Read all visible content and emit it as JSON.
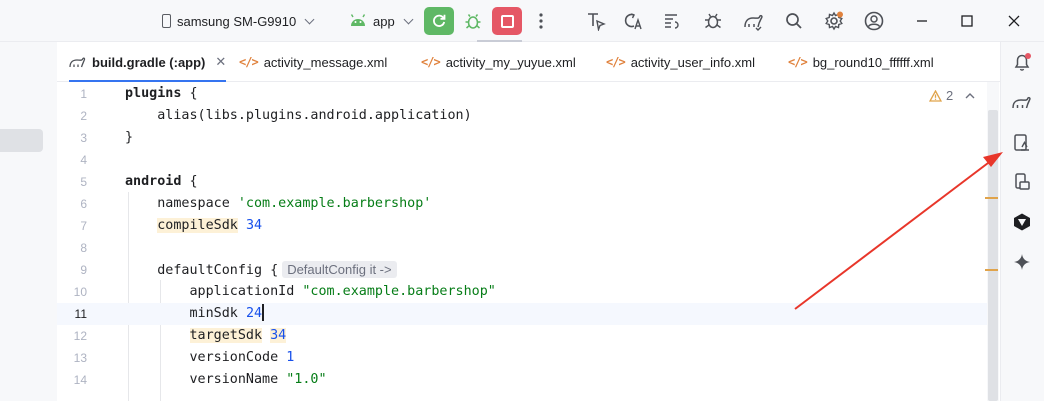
{
  "toolbar": {
    "device_name": "samsung SM-G9910",
    "run_config": "app"
  },
  "tabs": [
    {
      "label": "build.gradle (:app)",
      "active": true
    },
    {
      "label": "activity_message.xml"
    },
    {
      "label": "activity_my_yuyue.xml"
    },
    {
      "label": "activity_user_info.xml"
    },
    {
      "label": "bg_round10_ffffff.xml"
    }
  ],
  "editor": {
    "warning_count": "2",
    "current_line": 11,
    "line_numbers": [
      "1",
      "2",
      "3",
      "4",
      "5",
      "6",
      "7",
      "8",
      "9",
      "10",
      "11",
      "12",
      "13",
      "14"
    ],
    "code": {
      "plugins": "plugins",
      "alias_call": "alias(libs.plugins.android.application)",
      "android": "android",
      "namespace_key": "namespace",
      "namespace_val": "'com.example.barbershop'",
      "compileSdk_key": "compileSdk",
      "compileSdk_val": "34",
      "defaultConfig": "defaultConfig",
      "defaultConfig_hint": "DefaultConfig it ->",
      "applicationId_key": "applicationId",
      "applicationId_val": "\"com.example.barbershop\"",
      "minSdk_key": "minSdk",
      "minSdk_val": "24",
      "targetSdk_key": "targetSdk",
      "targetSdk_val": "34",
      "versionCode_key": "versionCode",
      "versionCode_val": "1",
      "versionName_key": "versionName",
      "versionName_val": "\"1.0\""
    }
  },
  "right_strip": {
    "icons": [
      "notifications-icon",
      "gradle-icon",
      "device-manager-icon",
      "running-devices-icon",
      "copilot-icon",
      "gemini-icon"
    ]
  },
  "colors": {
    "accent": "#3574f0",
    "run_green": "#5fb865",
    "stop_red": "#e55765",
    "annotation_arrow": "#e8362a"
  }
}
